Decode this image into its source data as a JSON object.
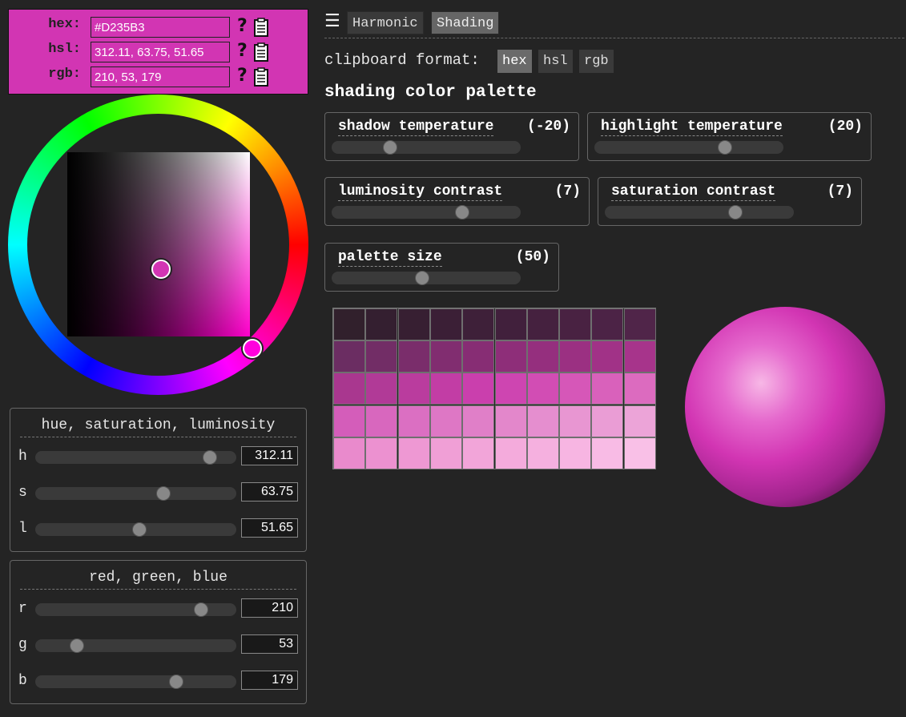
{
  "color": {
    "hex_label": "hex:",
    "hsl_label": "hsl:",
    "rgb_label": "rgb:",
    "hex_value": "#D235B3",
    "hsl_value": "312.11, 63.75, 51.65",
    "rgb_value": "210, 53, 179",
    "accent": "#D235B3",
    "help_glyph": "?"
  },
  "hsl_panel": {
    "title": "hue, saturation, luminosity",
    "rows": [
      {
        "label": "h",
        "value": "312.11",
        "fraction": 0.867
      },
      {
        "label": "s",
        "value": "63.75",
        "fraction": 0.6375
      },
      {
        "label": "l",
        "value": "51.65",
        "fraction": 0.5165
      }
    ]
  },
  "rgb_panel": {
    "title": "red, green, blue",
    "rows": [
      {
        "label": "r",
        "value": "210",
        "fraction": 0.8235
      },
      {
        "label": "g",
        "value": "53",
        "fraction": 0.2078
      },
      {
        "label": "b",
        "value": "179",
        "fraction": 0.702
      }
    ]
  },
  "nav": {
    "menu_icon": "☰",
    "tabs": [
      {
        "label": "Harmonic",
        "active": false
      },
      {
        "label": "Shading",
        "active": true
      }
    ]
  },
  "clipboard": {
    "label": "clipboard format:",
    "options": [
      {
        "label": "hex",
        "active": true
      },
      {
        "label": "hsl",
        "active": false
      },
      {
        "label": "rgb",
        "active": false
      }
    ]
  },
  "shading": {
    "title": "shading color palette",
    "controls": [
      {
        "label": "shadow temperature",
        "value": "(-20)",
        "fraction": 0.31
      },
      {
        "label": "highlight temperature",
        "value": "(20)",
        "fraction": 0.69
      },
      {
        "label": "luminosity contrast",
        "value": "(7)",
        "fraction": 0.69
      },
      {
        "label": "saturation contrast",
        "value": "(7)",
        "fraction": 0.69
      },
      {
        "label": "palette size",
        "value": "(50)",
        "fraction": 0.48
      }
    ],
    "palette_rows": [
      [
        "#31202C",
        "#341F30",
        "#371F32",
        "#3B1F36",
        "#3E2039",
        "#41203C",
        "#45213F",
        "#492242",
        "#4C2346",
        "#502549"
      ],
      [
        "#6B2D62",
        "#722D66",
        "#7A2D6B",
        "#812D70",
        "#872D74",
        "#8E2E79",
        "#952F7E",
        "#9B3082",
        "#A13287",
        "#A7348B"
      ],
      [
        "#A9378F",
        "#B13A97",
        "#BA3C9E",
        "#C23DA5",
        "#CA3FAD",
        "#CE45B1",
        "#D24DB4",
        "#D657B8",
        "#D961BB",
        "#DC6BBF"
      ],
      [
        "#D45DBA",
        "#D867BE",
        "#DB6FC2",
        "#DE77C5",
        "#E07FC8",
        "#E387CB",
        "#E58ECF",
        "#E896D2",
        "#EA9DD5",
        "#ECA4D8"
      ],
      [
        "#E98ACC",
        "#EC91D0",
        "#EE98D3",
        "#F09FD6",
        "#F2A5D9",
        "#F4ABDC",
        "#F5B0DF",
        "#F7B5E2",
        "#F8BBE5",
        "#F9C0E7"
      ]
    ]
  }
}
